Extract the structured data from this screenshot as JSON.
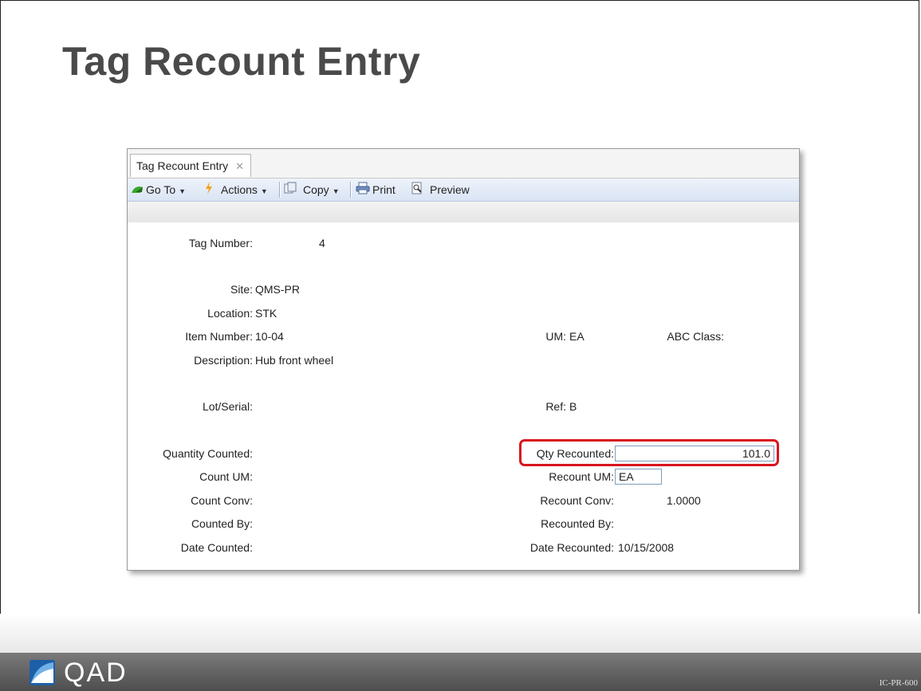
{
  "slide": {
    "title": "Tag Recount Entry",
    "brand": "QAD",
    "code": "IC-PR-600"
  },
  "window": {
    "tab_label": "Tag Recount Entry",
    "tab_close": "✕",
    "toolbar": {
      "goto_label": "Go To",
      "actions_label": "Actions",
      "copy_label": "Copy",
      "print_label": "Print",
      "preview_label": "Preview"
    }
  },
  "form": {
    "tag_number_label": "Tag Number:",
    "tag_number_value": "4",
    "site_label": "Site:",
    "site_value": "QMS-PR",
    "location_label": "Location:",
    "location_value": "STK",
    "item_number_label": "Item Number:",
    "item_number_value": "10-04",
    "um_label": "UM:",
    "um_value": "EA",
    "abc_class_label": "ABC Class:",
    "description_label": "Description:",
    "description_value": "Hub front wheel",
    "lot_serial_label": "Lot/Serial:",
    "ref_label": "Ref:",
    "ref_value": "B",
    "quantity_counted_label": "Quantity Counted:",
    "qty_recounted_label": "Qty Recounted:",
    "qty_recounted_value": "101.0",
    "count_um_label": "Count UM:",
    "recount_um_label": "Recount UM:",
    "recount_um_value": "EA",
    "count_conv_label": "Count Conv:",
    "recount_conv_label": "Recount Conv:",
    "recount_conv_value": "1.0000",
    "counted_by_label": "Counted By:",
    "recounted_by_label": "Recounted By:",
    "date_counted_label": "Date Counted:",
    "date_recounted_label": "Date Recounted:",
    "date_recounted_value": "10/15/2008"
  },
  "colors": {
    "highlight": "#d8141c",
    "title": "#4a4a4a",
    "toolbar": "#d9e4f4"
  }
}
